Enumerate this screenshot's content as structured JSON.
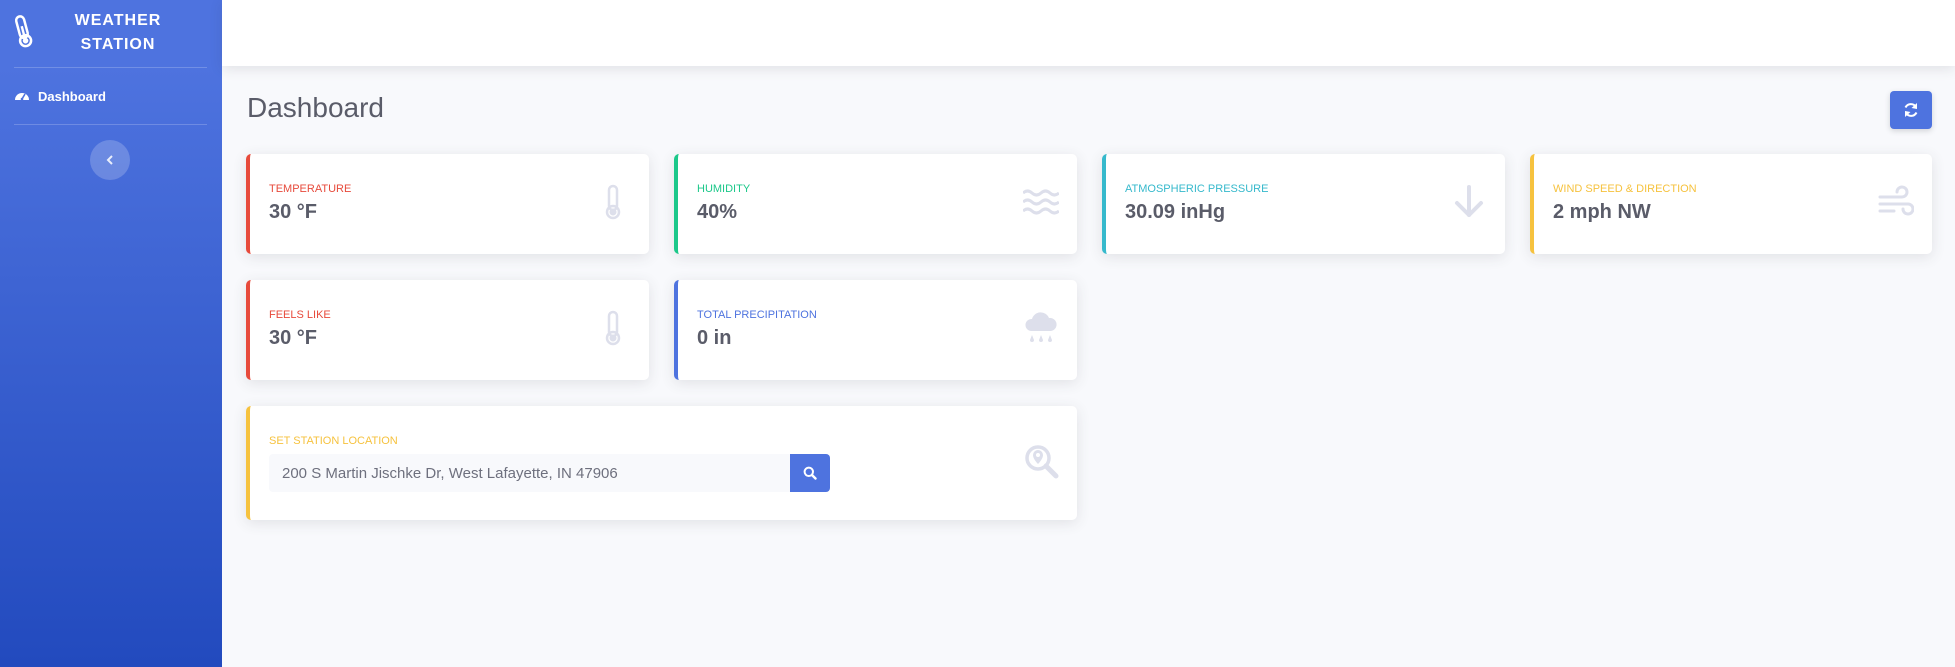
{
  "sidebar": {
    "brand": "WEATHER STATION",
    "nav": [
      {
        "label": "Dashboard",
        "icon": "tachometer-icon"
      }
    ]
  },
  "main": {
    "title": "Dashboard",
    "cards": {
      "temperature": {
        "label": "TEMPERATURE",
        "value": "30 °F",
        "icon": "thermometer-icon",
        "color": "#e74a3b"
      },
      "humidity": {
        "label": "HUMIDITY",
        "value": "40%",
        "icon": "water-icon",
        "color": "#1cc88a"
      },
      "pressure": {
        "label": "ATMOSPHERIC PRESSURE",
        "value": "30.09 inHg",
        "icon": "arrow-down-icon",
        "color": "#36b9cc"
      },
      "wind": {
        "label": "WIND SPEED & DIRECTION",
        "value": "2 mph NW",
        "icon": "wind-icon",
        "color": "#f6c23e"
      },
      "feels_like": {
        "label": "FEELS LIKE",
        "value": "30 °F",
        "icon": "thermometer-icon",
        "color": "#e74a3b"
      },
      "precipitation": {
        "label": "TOTAL PRECIPITATION",
        "value": "0 in",
        "icon": "cloud-rain-icon",
        "color": "#4e73df"
      }
    },
    "location": {
      "label": "SET STATION LOCATION",
      "value": "200 S Martin Jischke Dr, West Lafayette, IN 47906",
      "icon": "search-location-icon",
      "color": "#f6c23e"
    }
  },
  "colors": {
    "primary": "#4e73df",
    "icon_muted": "#dddfeb",
    "text": "#5a5c69"
  }
}
